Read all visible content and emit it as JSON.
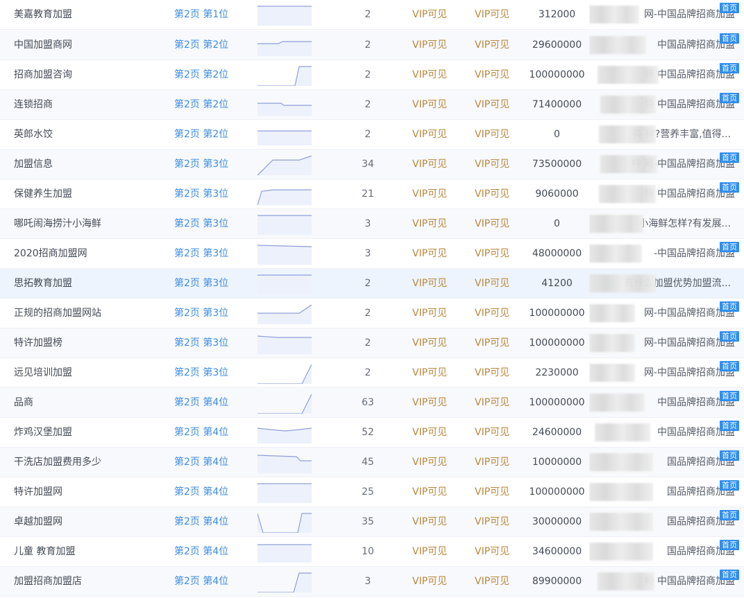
{
  "table": {
    "rows": [
      {
        "keyword": "美嘉教育加盟",
        "rank": "第2页 第1位",
        "count": "2",
        "vip_a": "VIP可见",
        "vip_b": "VIP可见",
        "index": "312000",
        "title": "网-中国品牌招商加盟",
        "home_badge": "首页"
      },
      {
        "keyword": "中国加盟商网",
        "rank": "第2页 第2位",
        "count": "2",
        "vip_a": "VIP可见",
        "vip_b": "VIP可见",
        "index": "29600000",
        "title": "中国品牌招商加盟",
        "home_badge": "首页"
      },
      {
        "keyword": "招商加盟咨询",
        "rank": "第2页 第2位",
        "count": "2",
        "vip_a": "VIP可见",
        "vip_b": "VIP可见",
        "index": "100000000",
        "title": "特 中国品牌招商加盟",
        "home_badge": "首页"
      },
      {
        "keyword": "连锁招商",
        "rank": "第2页 第2位",
        "count": "2",
        "vip_a": "VIP可见",
        "vip_b": "VIP可见",
        "index": "71400000",
        "title": "特 中国品牌招商加盟",
        "home_badge": "首页"
      },
      {
        "keyword": "英郎水饺",
        "rank": "第2页 第2位",
        "count": "2",
        "vip_a": "VIP可见",
        "vip_b": "VIP可见",
        "index": "0",
        "title": "英 样?营养丰富,值得...",
        "home_badge": ""
      },
      {
        "keyword": "加盟信息",
        "rank": "第2页 第3位",
        "count": "34",
        "vip_a": "VIP可见",
        "vip_b": "VIP可见",
        "index": "73500000",
        "title": "特 网-中国品牌招商加盟",
        "home_badge": "首页"
      },
      {
        "keyword": "保健养生加盟",
        "rank": "第2页 第3位",
        "count": "21",
        "vip_a": "VIP可见",
        "vip_b": "VIP可见",
        "index": "9060000",
        "title": "特 中国品牌招商加盟",
        "home_badge": "首页"
      },
      {
        "keyword": "哪吒闹海捞汁小海鲜",
        "rank": "第2页 第3位",
        "count": "3",
        "vip_a": "VIP可见",
        "vip_b": "VIP可见",
        "index": "0",
        "title": "小海鲜怎样?有发展...",
        "home_badge": ""
      },
      {
        "keyword": "2020招商加盟网",
        "rank": "第2页 第3位",
        "count": "3",
        "vip_a": "VIP可见",
        "vip_b": "VIP可见",
        "index": "48000000",
        "title": "-中国品牌招商加盟",
        "home_badge": "首页"
      },
      {
        "keyword": "思拓教育加盟",
        "rank": "第2页 第3位",
        "count": "2",
        "vip_a": "VIP可见",
        "vip_b": "VIP可见",
        "index": "41200",
        "title": "有什么加盟优势加盟流...",
        "home_badge": ""
      },
      {
        "keyword": "正规的招商加盟网站",
        "rank": "第2页 第3位",
        "count": "2",
        "vip_a": "VIP可见",
        "vip_b": "VIP可见",
        "index": "100000000",
        "title": "网-中国品牌招商加盟",
        "home_badge": "首页"
      },
      {
        "keyword": "特许加盟榜",
        "rank": "第2页 第3位",
        "count": "2",
        "vip_a": "VIP可见",
        "vip_b": "VIP可见",
        "index": "100000000",
        "title": "网-中国品牌招商加盟",
        "home_badge": "首页"
      },
      {
        "keyword": "远见培训加盟",
        "rank": "第2页 第3位",
        "count": "2",
        "vip_a": "VIP可见",
        "vip_b": "VIP可见",
        "index": "2230000",
        "title": "网-中国品牌招商加盟",
        "home_badge": "首页"
      },
      {
        "keyword": "品商",
        "rank": "第2页 第4位",
        "count": "63",
        "vip_a": "VIP可见",
        "vip_b": "VIP可见",
        "index": "100000000",
        "title": "中国品牌招商加盟",
        "home_badge": "首页"
      },
      {
        "keyword": "炸鸡汉堡加盟",
        "rank": "第2页 第4位",
        "count": "52",
        "vip_a": "VIP可见",
        "vip_b": "VIP可见",
        "index": "24600000",
        "title": "中国品牌招商加盟",
        "home_badge": "首页"
      },
      {
        "keyword": "干洗店加盟费用多少",
        "rank": "第2页 第4位",
        "count": "45",
        "vip_a": "VIP可见",
        "vip_b": "VIP可见",
        "index": "10000000",
        "title": "国品牌招商加盟",
        "home_badge": "首页"
      },
      {
        "keyword": "特许加盟网",
        "rank": "第2页 第4位",
        "count": "25",
        "vip_a": "VIP可见",
        "vip_b": "VIP可见",
        "index": "100000000",
        "title": "国品牌招商加盟",
        "home_badge": "首页"
      },
      {
        "keyword": "卓越加盟网",
        "rank": "第2页 第4位",
        "count": "35",
        "vip_a": "VIP可见",
        "vip_b": "VIP可见",
        "index": "30000000",
        "title": "国品牌招商加盟",
        "home_badge": "首页"
      },
      {
        "keyword": "儿童 教育加盟",
        "rank": "第2页 第4位",
        "count": "10",
        "vip_a": "VIP可见",
        "vip_b": "VIP可见",
        "index": "34600000",
        "title": "国品牌招商加盟",
        "home_badge": "首页"
      },
      {
        "keyword": "加盟招商加盟店",
        "rank": "第2页 第4位",
        "count": "3",
        "vip_a": "VIP可见",
        "vip_b": "VIP可见",
        "index": "89900000",
        "title": "特 中国品牌招商加盟",
        "home_badge": "首页"
      }
    ]
  },
  "colors": {
    "rank_link": "#3d8ce0",
    "vip_text": "#b8873c",
    "badge_bg": "#2f8ef0",
    "spark_line": "#8f9fd8",
    "spark_fill": "#edf1fb"
  }
}
